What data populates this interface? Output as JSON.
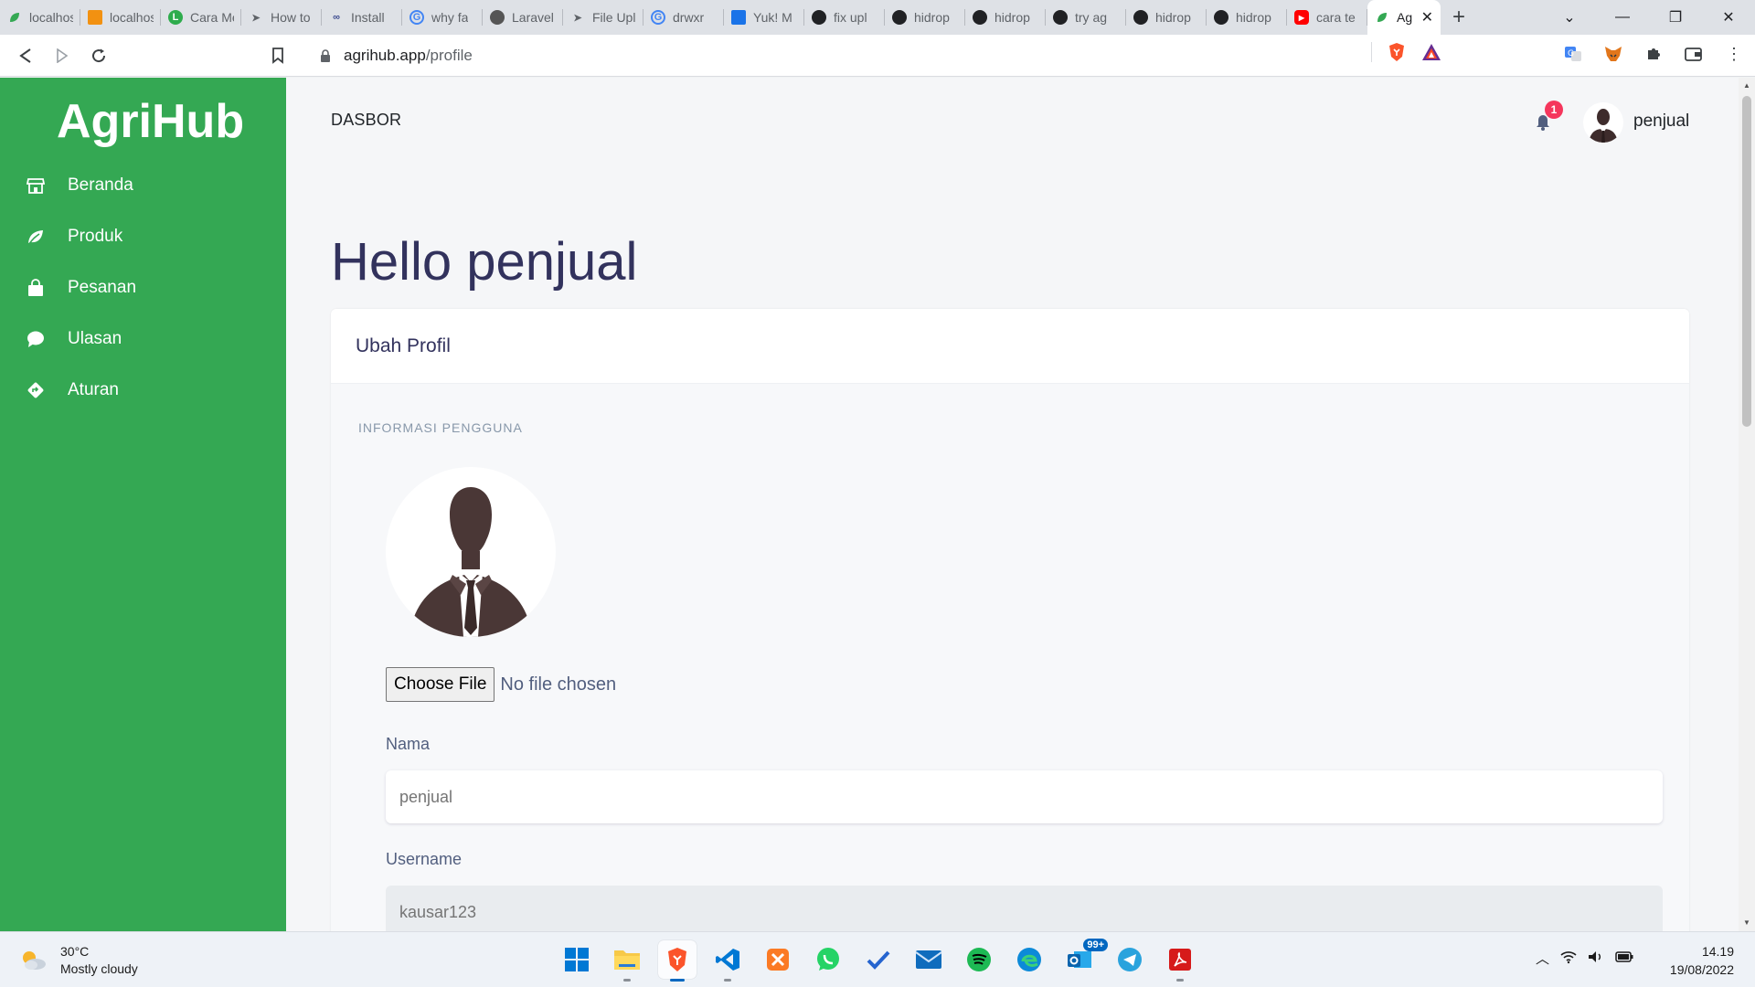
{
  "browser": {
    "tabs": [
      {
        "label": "localhost",
        "icon": "leaf-icon",
        "color": "#34a853"
      },
      {
        "label": "localhost",
        "icon": "phpmyadmin-icon",
        "color": "#f29111"
      },
      {
        "label": "Cara Membuat",
        "icon": "letter-l-icon",
        "color": "#2eac4d"
      },
      {
        "label": "How to",
        "icon": "paper-plane-icon",
        "color": "#5f6368"
      },
      {
        "label": "Install",
        "icon": "link-icon",
        "color": "#3c4b8f"
      },
      {
        "label": "why fa",
        "icon": "google-icon",
        "color": "#4285f4"
      },
      {
        "label": "Laravel",
        "icon": "laravel-icon",
        "color": "#555"
      },
      {
        "label": "File Upl",
        "icon": "paper-plane-icon",
        "color": "#5f6368"
      },
      {
        "label": "drwxr",
        "icon": "google-icon",
        "color": "#4285f4"
      },
      {
        "label": "Yuk! M",
        "icon": "chart-icon",
        "color": "#1a73e8"
      },
      {
        "label": "fix upl",
        "icon": "github-icon",
        "color": "#202124"
      },
      {
        "label": "hidrop",
        "icon": "github-icon",
        "color": "#202124"
      },
      {
        "label": "hidrop",
        "icon": "github-icon",
        "color": "#202124"
      },
      {
        "label": "try ag",
        "icon": "github-icon",
        "color": "#202124"
      },
      {
        "label": "hidrop",
        "icon": "github-icon",
        "color": "#202124"
      },
      {
        "label": "hidrop",
        "icon": "github-icon",
        "color": "#202124"
      },
      {
        "label": "cara te",
        "icon": "youtube-icon",
        "color": "#ff0000"
      }
    ],
    "active_tab": {
      "label": "Ag",
      "icon": "leaf-icon"
    },
    "url_host": "agrihub.app",
    "url_path": "/profile"
  },
  "sidebar": {
    "brand": "AgriHub",
    "items": [
      {
        "label": "Beranda",
        "icon": "store-icon"
      },
      {
        "label": "Produk",
        "icon": "leaf-icon"
      },
      {
        "label": "Pesanan",
        "icon": "shopping-bag-icon"
      },
      {
        "label": "Ulasan",
        "icon": "chat-bubble-icon"
      },
      {
        "label": "Aturan",
        "icon": "directions-icon"
      }
    ]
  },
  "topbar": {
    "title": "DASBOR",
    "notification_count": "1",
    "username": "penjual"
  },
  "main": {
    "greeting": "Hello penjual",
    "card_title": "Ubah Profil",
    "section_label": "INFORMASI PENGGUNA",
    "file_button": "Choose File",
    "file_status": "No file chosen",
    "fields": [
      {
        "label": "Nama",
        "value": "penjual",
        "disabled": false
      },
      {
        "label": "Username",
        "value": "kausar123",
        "disabled": true
      }
    ]
  },
  "taskbar": {
    "weather_temp": "30°C",
    "weather_desc": "Mostly cloudy",
    "mail_badge": "99+",
    "time": "14.19",
    "date": "19/08/2022"
  },
  "colors": {
    "sidebar": "#34a853",
    "heading": "#32325d",
    "badge": "#f5365c"
  }
}
